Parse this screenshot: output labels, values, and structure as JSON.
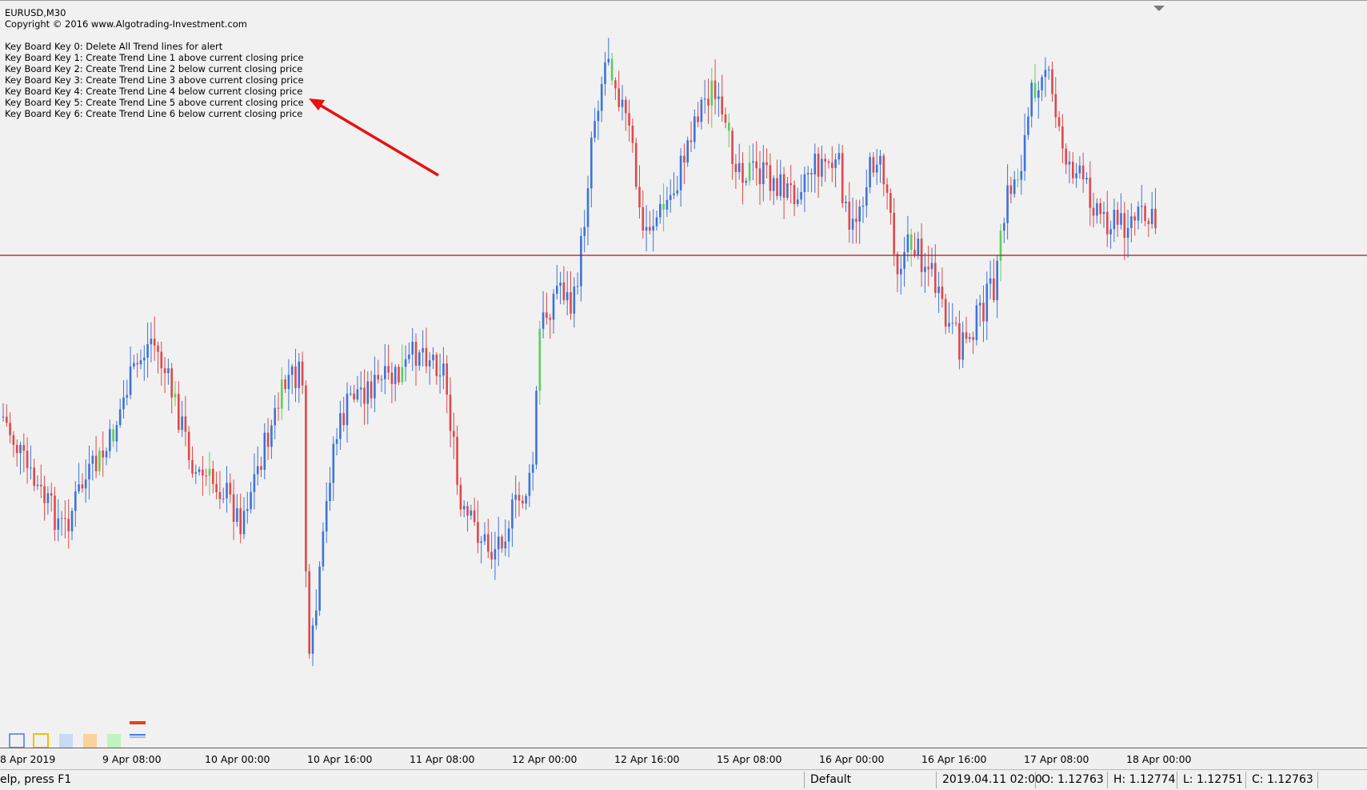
{
  "chart": {
    "symbol": "EURUSD,M30",
    "copyright": "Copyright © 2016 www.Algotrading-Investment.com",
    "key_lines": [
      "Key Board Key 0: Delete All Trend lines for alert",
      "Key Board Key 1: Create Trend Line 1 above current closing price",
      "Key Board Key 2: Create Trend Line 2 below current closing price",
      "Key Board Key 3: Create Trend Line 3 above current closing price",
      "Key Board Key 4: Create Trend Line 4 below current closing price",
      "Key Board Key 5: Create Trend Line 5 above current closing price",
      "Key Board Key 6: Create Trend Line 6 below current closing price"
    ],
    "x_labels": [
      "8 Apr 2019",
      "9 Apr 08:00",
      "10 Apr 00:00",
      "10 Apr 16:00",
      "11 Apr 08:00",
      "12 Apr 00:00",
      "12 Apr 16:00",
      "15 Apr 08:00",
      "16 Apr 00:00",
      "16 Apr 16:00",
      "17 Apr 08:00",
      "18 Apr 00:00"
    ],
    "colors": {
      "bull": "#3d73d9",
      "bear": "#e0484a",
      "neutral": "#5ccf5c",
      "hline": "#9c1c1c",
      "arrow": "#e81010"
    },
    "icons": [
      "blank-square-icon",
      "yellow-square-icon",
      "lightblue-square-icon",
      "orange-square-icon",
      "green-square-icon",
      "trendline-toggle-icon"
    ]
  },
  "statusbar": {
    "help": "elp, press F1",
    "profile": "Default",
    "datetime": "2019.04.11 02:00",
    "open": "O: 1.12763",
    "high": "H: 1.12774",
    "low": "L: 1.12751",
    "close": "C: 1.12763"
  }
}
